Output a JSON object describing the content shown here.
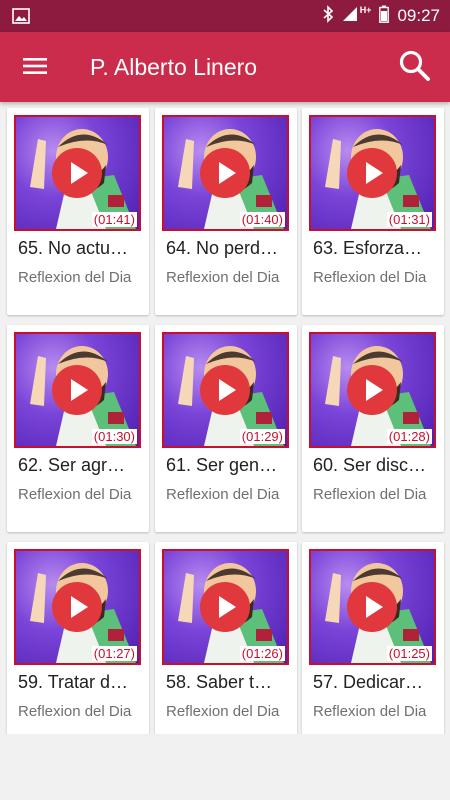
{
  "status_bar": {
    "time": "09:27",
    "network_label": "H+",
    "icons": [
      "image-icon",
      "bluetooth-icon",
      "signal-icon",
      "battery-icon"
    ]
  },
  "app_bar": {
    "title": "P. Alberto Linero",
    "menu_icon": "menu-icon",
    "search_icon": "search-icon"
  },
  "colors": {
    "status_bar": "#8d1a3f",
    "app_bar": "#cc2c4c",
    "accent_red": "#c8102e",
    "background": "#f1f1f1"
  },
  "videos": [
    {
      "title": "65. No actu…",
      "category": "Reflexion del Dia",
      "duration": "(01:41)"
    },
    {
      "title": "64. No perd…",
      "category": "Reflexion del Dia",
      "duration": "(01:40)"
    },
    {
      "title": "63. Esforza…",
      "category": "Reflexion del Dia",
      "duration": "(01:31)"
    },
    {
      "title": "62. Ser agr…",
      "category": "Reflexion del Dia",
      "duration": "(01:30)"
    },
    {
      "title": "61. Ser gen…",
      "category": "Reflexion del Dia",
      "duration": "(01:29)"
    },
    {
      "title": "60. Ser disc…",
      "category": "Reflexion del Dia",
      "duration": "(01:28)"
    },
    {
      "title": "59. Tratar d…",
      "category": "Reflexion del Dia",
      "duration": "(01:27)"
    },
    {
      "title": "58. Saber t…",
      "category": "Reflexion del Dia",
      "duration": "(01:26)"
    },
    {
      "title": "57. Dedicar…",
      "category": "Reflexion del Dia",
      "duration": "(01:25)"
    }
  ]
}
